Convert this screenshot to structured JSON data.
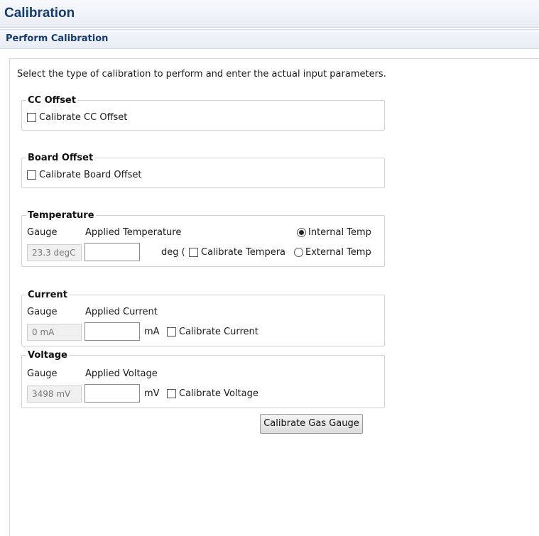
{
  "window": {
    "title": "Calibration"
  },
  "section": {
    "title": "Perform Calibration"
  },
  "intro": "Select the type of calibration to perform and enter the actual input parameters.",
  "cc_offset": {
    "legend": "CC Offset",
    "checkbox_label": "Calibrate CC Offset",
    "checked": false
  },
  "board_offset": {
    "legend": "Board Offset",
    "checkbox_label": "Calibrate Board Offset",
    "checked": false
  },
  "temperature": {
    "legend": "Temperature",
    "gauge_label": "Gauge",
    "applied_label": "Applied Temperature",
    "gauge_value": "23.3 degC",
    "applied_value": "",
    "unit": "deg (",
    "checkbox_label": "Calibrate Tempera",
    "checked": false,
    "radio_internal": "Internal Temp",
    "radio_external": "External Temp",
    "selected_source": "Internal Temp"
  },
  "current": {
    "legend": "Current",
    "gauge_label": "Gauge",
    "applied_label": "Applied Current",
    "gauge_value": "0 mA",
    "applied_value": "",
    "unit": "mA",
    "checkbox_label": "Calibrate Current",
    "checked": false
  },
  "voltage": {
    "legend": "Voltage",
    "gauge_label": "Gauge",
    "applied_label": "Applied Voltage",
    "gauge_value": "3498 mV",
    "applied_value": "",
    "unit": "mV",
    "checkbox_label": "Calibrate Voltage",
    "checked": false
  },
  "actions": {
    "calibrate_button": "Calibrate Gas Gauge"
  }
}
